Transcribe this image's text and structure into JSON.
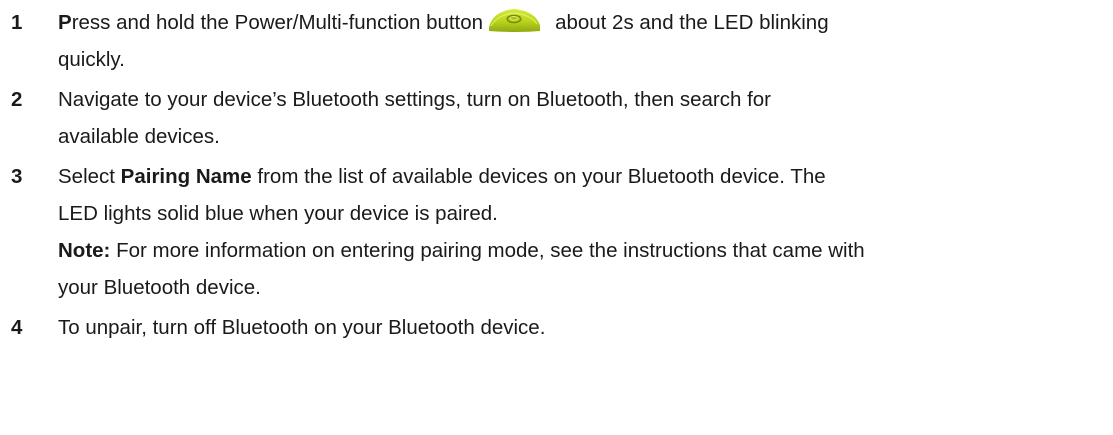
{
  "steps": [
    {
      "number": "1",
      "line1_lead": "P",
      "line1_rest": "ress and hold the Power/Multi-function button",
      "line1_after_icon": "about 2s and the LED blinking",
      "line2": "quickly.",
      "icon": "power-multifunction-button-icon"
    },
    {
      "number": "2",
      "line1": "Navigate to your device’s Bluetooth settings, turn on Bluetooth, then search for",
      "line2": "available devices."
    },
    {
      "number": "3",
      "line1_pre": "Select ",
      "line1_bold": "Pairing Name",
      "line1_post": " from the list of available devices on your Bluetooth device. The",
      "line2": "LED lights solid blue when your device is paired.",
      "note_label": "Note:",
      "note_line1": " For more information on entering pairing mode, see the instructions that came with",
      "note_line2": "your Bluetooth device."
    },
    {
      "number": "4",
      "line1": "To unpair, turn off Bluetooth on your Bluetooth device."
    }
  ],
  "colors": {
    "text": "#1a1a1a",
    "button_green": "#b9d31c"
  }
}
